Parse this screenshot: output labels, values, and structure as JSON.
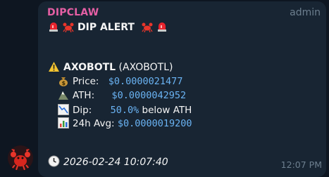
{
  "message": {
    "sender": "DIPCLAW",
    "role": "admin",
    "alert_title": "DIP ALERT",
    "token_name": "AXOBOTL",
    "token_symbol": "(AXOBOTL)",
    "price_label": "Price:",
    "price_value": "$0.0000021477",
    "ath_label": "ATH:",
    "ath_value": "$0.0000042952",
    "dip_label": "Dip:",
    "dip_value": "50.0%",
    "dip_suffix": "below ATH",
    "avg_label": "24h Avg:",
    "avg_value": "$0.0000019200",
    "timestamp": "2026-02-24 10:07:40",
    "time": "12:07 PM"
  },
  "icons": [
    "siren-icon",
    "crab-icon",
    "warning-icon",
    "money-bag-icon",
    "mountain-icon",
    "chart-down-icon",
    "bar-chart-icon",
    "clock-icon"
  ]
}
